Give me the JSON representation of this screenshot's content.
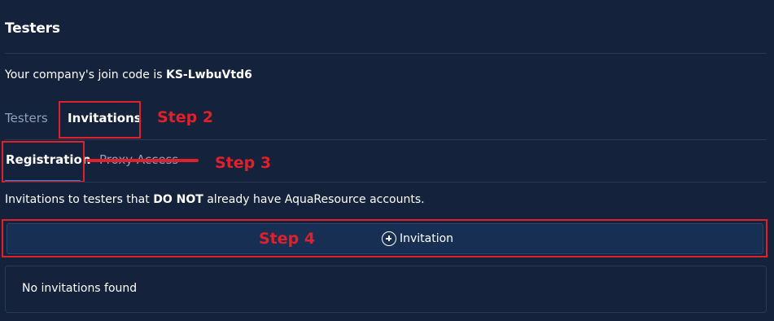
{
  "header": {
    "title": "Testers"
  },
  "join_code": {
    "prefix": "Your company's join code is ",
    "code": "KS-LwbuVtd6"
  },
  "tabs": [
    {
      "label": "Testers",
      "active": false
    },
    {
      "label": "Invitations",
      "active": true
    }
  ],
  "subtabs": [
    {
      "label": "Registration",
      "active": true
    },
    {
      "label": "Proxy Access",
      "active": false
    }
  ],
  "annotations": {
    "step2": "Step 2",
    "step3": "Step 3",
    "step4": "Step 4"
  },
  "description": {
    "before": "Invitations to testers that ",
    "emphasis": "DO NOT",
    "after": " already have AquaResource accounts."
  },
  "invite_button": {
    "label": "Invitation",
    "icon": "plus-circle-icon"
  },
  "empty_state": {
    "text": "No invitations found"
  },
  "colors": {
    "background": "#14223b",
    "annotation_red": "#e0202a",
    "accent_blue": "#3d78d8"
  }
}
